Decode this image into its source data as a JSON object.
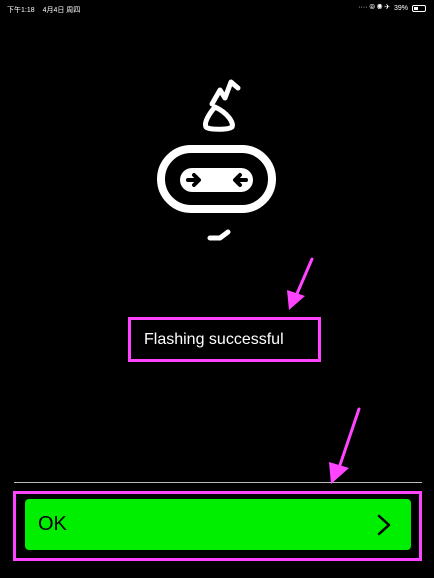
{
  "status_bar": {
    "time": "下午1:18",
    "date": "4月4日 周四",
    "indicators": "····  ⦾ ◉ ✈",
    "battery_percent": "39%",
    "battery_level": 0.39
  },
  "illustration": {
    "icon": "microbit-robot-icon"
  },
  "message": {
    "text": "Flashing successful"
  },
  "ok_button": {
    "label": "OK",
    "icon": "chevron-right-icon"
  },
  "colors": {
    "background": "#000000",
    "button_green": "#00ee00",
    "highlight_magenta": "#ff44ff"
  }
}
